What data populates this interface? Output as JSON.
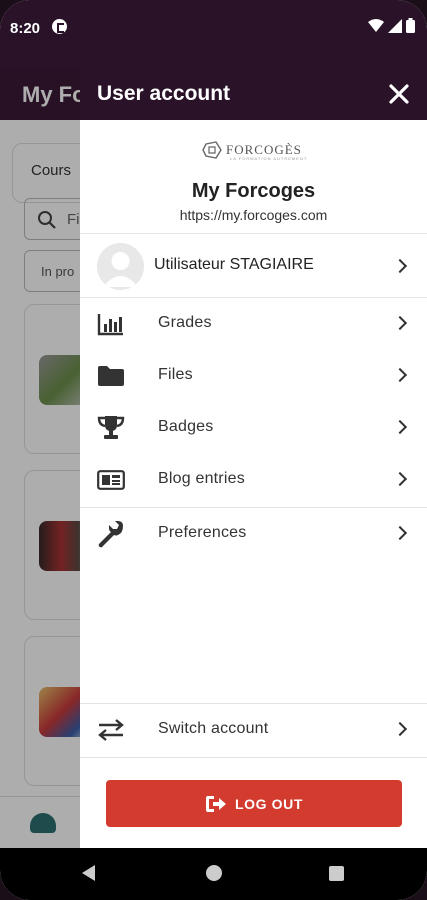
{
  "status_bar": {
    "time": "8:20"
  },
  "background_app": {
    "title": "My Fo",
    "tab_label": "Cours",
    "search_placeholder": "Fi",
    "filter_label": "In pro"
  },
  "drawer": {
    "title": "User account",
    "site": {
      "logo_text": "FORCOGÈS",
      "logo_subtext": "LA FORMATION AUTREMENT",
      "name": "My Forcoges",
      "url": "https://my.forcoges.com"
    },
    "user": {
      "name": "Utilisateur STAGIAIRE"
    },
    "menu": [
      {
        "label": "Grades",
        "icon": "grades-chart-icon"
      },
      {
        "label": "Files",
        "icon": "folder-icon"
      },
      {
        "label": "Badges",
        "icon": "trophy-icon"
      },
      {
        "label": "Blog entries",
        "icon": "blog-card-icon"
      },
      {
        "label": "Preferences",
        "icon": "wrench-icon"
      }
    ],
    "switch_account": "Switch account",
    "logout_label": "LOG OUT"
  },
  "colors": {
    "header_bg": "#2a1229",
    "logout_bg": "#d33b2e",
    "accent_teal": "#2d6f6f"
  }
}
